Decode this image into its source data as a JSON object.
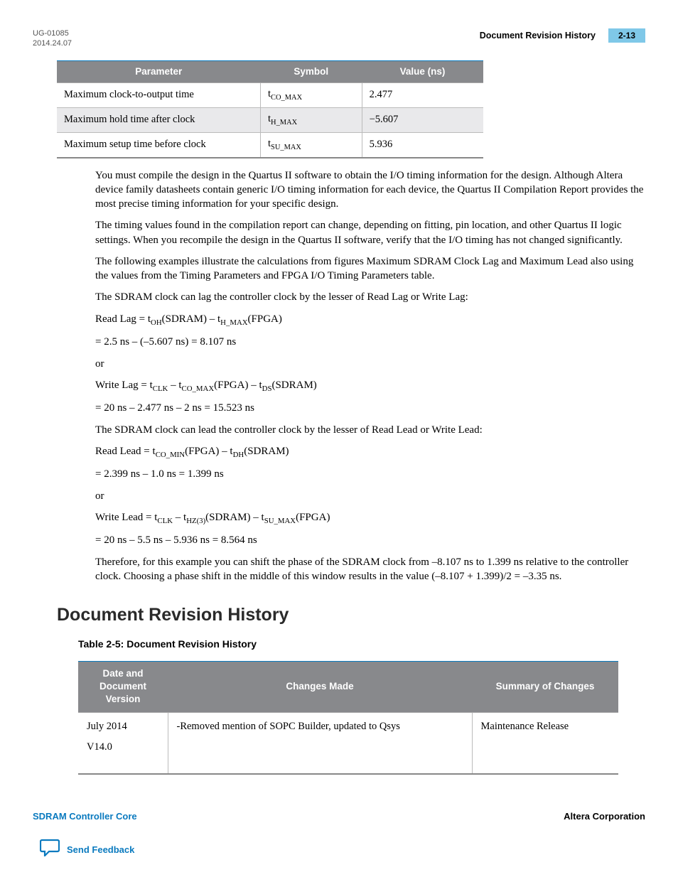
{
  "header": {
    "doc_id": "UG-01085",
    "date": "2014.24.07",
    "title": "Document Revision History",
    "page": "2-13"
  },
  "timing_table": {
    "headers": [
      "Parameter",
      "Symbol",
      "Value (ns)"
    ],
    "rows": [
      {
        "param": "Maximum clock-to-output time",
        "sym_base": "t",
        "sym_sub": "CO_MAX",
        "value": "2.477"
      },
      {
        "param": "Maximum hold time after clock",
        "sym_base": "t",
        "sym_sub": "H_MAX",
        "value": "−5.607"
      },
      {
        "param": "Maximum setup time before clock",
        "sym_base": "t",
        "sym_sub": "SU_MAX",
        "value": "5.936"
      }
    ]
  },
  "body": {
    "p1": "You must compile the design in the Quartus II software to obtain the I/O timing information for the design. Although Altera device family datasheets contain generic I/O timing information for each device, the Quartus II Compilation Report provides the most precise timing information for your specific design.",
    "p2": "The timing values found in the compilation report can change, depending on fitting, pin location, and other Quartus II logic settings. When you recompile the design in the Quartus II software, verify that the I/O timing has not changed significantly.",
    "p3": "The following examples illustrate the calculations from figures Maximum SDRAM Clock Lag and Maximum Lead also using the values from the Timing Parameters and FPGA I/O Timing Parameters table.",
    "p4": "The SDRAM clock can lag the controller clock by the lesser of Read Lag or Write Lag:",
    "f1": {
      "pre": "Read Lag = t",
      "s1": "OH",
      "mid1": "(SDRAM) – t",
      "s2": "H_MAX",
      "post": "(FPGA)"
    },
    "r1": "= 2.5 ns – (–5.607 ns) = 8.107 ns",
    "or1": "or",
    "f2": {
      "pre": "Write Lag = t",
      "s1": "CLK",
      "mid1": " – t",
      "s2": "CO_MAX",
      "mid2": "(FPGA) – t",
      "s3": "DS",
      "post": "(SDRAM)"
    },
    "r2": "= 20 ns – 2.477 ns – 2 ns = 15.523 ns",
    "p5": "The SDRAM clock can lead the controller clock by the lesser of Read Lead or Write Lead:",
    "f3": {
      "pre": "Read Lead = t",
      "s1": "CO_MIN",
      "mid1": "(FPGA) – t",
      "s2": "DH",
      "post": "(SDRAM)"
    },
    "r3": "= 2.399 ns – 1.0 ns = 1.399 ns",
    "or2": "or",
    "f4": {
      "pre": "Write Lead = t",
      "s1": "CLK",
      "mid1": " – t",
      "s2": "HZ(3)",
      "mid2": "(SDRAM) – t",
      "s3": "SU_MAX",
      "post": "(FPGA)"
    },
    "r4": "= 20 ns – 5.5 ns – 5.936 ns = 8.564 ns",
    "p6": "Therefore, for this example you can shift the phase of the SDRAM clock from –8.107 ns to 1.399 ns relative to the controller clock. Choosing a phase shift in the middle of this window results in the value (–8.107 + 1.399)/2 = –3.35 ns."
  },
  "section_heading": "Document Revision History",
  "revision": {
    "caption": "Table 2-5: Document Revision History",
    "headers": [
      "Date and Document Version",
      "Changes Made",
      "Summary of Changes"
    ],
    "row": {
      "date": "July 2014",
      "version": "V14.0",
      "changes": "-Removed mention of SOPC Builder, updated to Qsys",
      "summary": "Maintenance Release"
    }
  },
  "footer": {
    "left": "SDRAM Controller Core",
    "right": "Altera Corporation",
    "feedback": "Send Feedback"
  }
}
